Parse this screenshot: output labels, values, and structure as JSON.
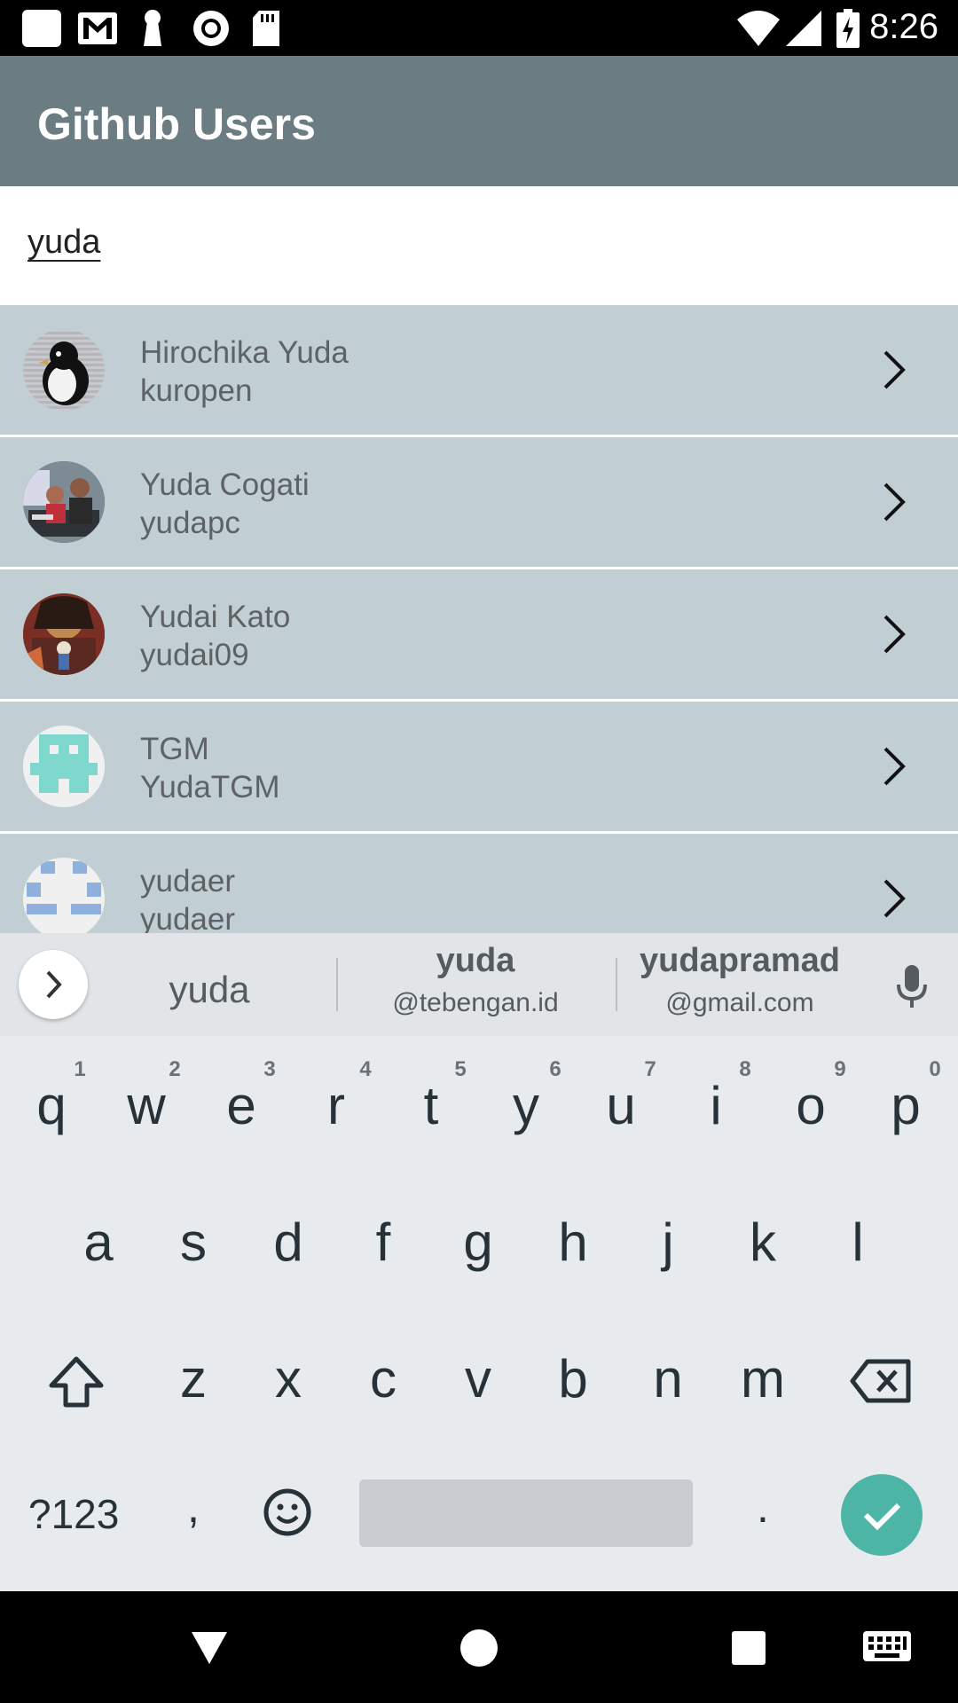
{
  "status_bar": {
    "time": "8:26"
  },
  "app_bar": {
    "title": "Github Users"
  },
  "search": {
    "value": "yuda"
  },
  "users": [
    {
      "name": "Hirochika Yuda",
      "login": "kuropen"
    },
    {
      "name": "Yuda Cogati",
      "login": "yudapc"
    },
    {
      "name": "Yudai Kato",
      "login": "yudai09"
    },
    {
      "name": "TGM",
      "login": "YudaTGM"
    },
    {
      "name": "yudaer",
      "login": "yudaer"
    }
  ],
  "keyboard": {
    "suggestions": {
      "first": "yuda",
      "second_top": "yuda",
      "second_bottom": "@tebengan.id",
      "third_top": "yudapramad",
      "third_bottom": "@gmail.com"
    },
    "row1": [
      "q",
      "w",
      "e",
      "r",
      "t",
      "y",
      "u",
      "i",
      "o",
      "p"
    ],
    "row1_hints": [
      "1",
      "2",
      "3",
      "4",
      "5",
      "6",
      "7",
      "8",
      "9",
      "0"
    ],
    "row2": [
      "a",
      "s",
      "d",
      "f",
      "g",
      "h",
      "j",
      "k",
      "l"
    ],
    "row3": [
      "z",
      "x",
      "c",
      "v",
      "b",
      "n",
      "m"
    ],
    "symbols_key": "?123",
    "comma_key": ",",
    "period_key": "."
  },
  "colors": {
    "app_bar": "#6b7d83",
    "list_item": "#c1ced4",
    "accent": "#4cb5a6"
  }
}
